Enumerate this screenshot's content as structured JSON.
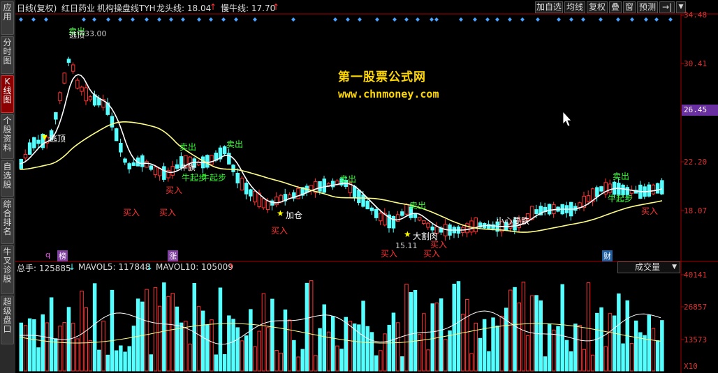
{
  "sidebar": {
    "items": [
      {
        "label": "应用",
        "active": false
      },
      {
        "label": "分时图",
        "active": false
      },
      {
        "label": "K线图",
        "active": true
      },
      {
        "label": "个股资料",
        "active": false
      },
      {
        "label": "自选股",
        "active": false
      },
      {
        "label": "综合排名",
        "active": false
      },
      {
        "label": "牛叉诊股",
        "active": false
      },
      {
        "label": "超级盘口",
        "active": false
      }
    ]
  },
  "header": {
    "period": "日线(复权)",
    "stock_name": "红日药业",
    "indicator": "机构操盘线TYH",
    "dragon_label": "龙头线: 18.04",
    "dragon_arrow": "↑",
    "slow_label": "慢牛线: 17.70",
    "slow_arrow": "↑",
    "buttons": [
      "加自选",
      "均线",
      "复权",
      "叠",
      "窗",
      "预测"
    ],
    "nav_icon": "→|",
    "dropdown_icon": "▼"
  },
  "price_axis": {
    "labels": [
      "34.48",
      "30.41",
      "26.45",
      "22.20",
      "18.07"
    ],
    "current": "26.45"
  },
  "annotations": {
    "escape_top_1": "逃顶",
    "escape_top_2": "逃顶",
    "price_high": "33.00",
    "sell": "卖出",
    "buy": "买入",
    "add_pos": "加仓",
    "big_cut": "大割肉",
    "careful": "小心要跌",
    "bull_start": "牛起步",
    "bull_flag": "牛旗",
    "price_low": "15.11",
    "flag_q": "q",
    "flag_list": "榜",
    "flag_up": "涨",
    "flag_fin": "财"
  },
  "watermark": {
    "line1": "第一股票公式网",
    "line2": "www.chnmoney.com"
  },
  "volume": {
    "total_label": "总手: 125885",
    "total_arrow": "↓",
    "ma5_label": "MAVOL5: 117848",
    "ma5_arrow": "↓",
    "ma10_label": "MAVOL10: 105009",
    "ma10_arrow": "↑",
    "selector": "成交量",
    "axis_labels": [
      "40141",
      "26857",
      "13573",
      "X10"
    ]
  },
  "colors": {
    "up": "#ff3333",
    "down": "#55ffff",
    "ma_fast": "#ffffff",
    "ma_slow": "#ffff88",
    "axis_text": "#dd3333",
    "signal_green": "#33ff33",
    "signal_yellow": "#ffff00",
    "diamond": "#4aa3ff",
    "current_price_bg": "#6a2fa0"
  }
}
